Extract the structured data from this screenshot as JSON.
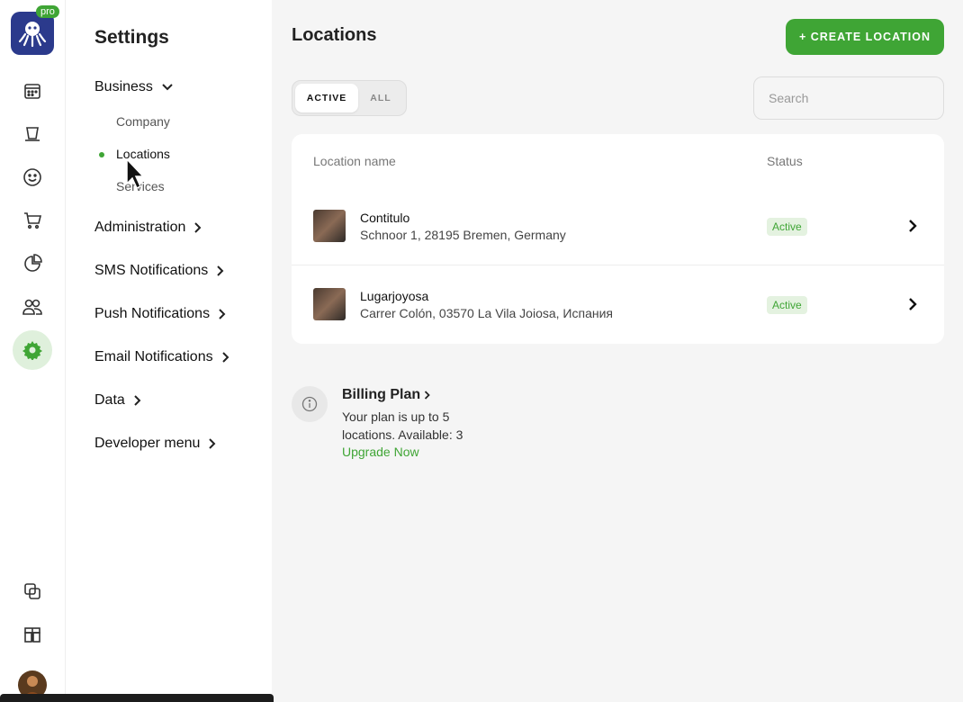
{
  "rail": {
    "pro_badge": "pro",
    "icons": [
      "calendar-icon",
      "inbox-icon",
      "smile-icon",
      "cart-icon",
      "pie-chart-icon",
      "users-icon",
      "settings-icon",
      "copy-icon",
      "apps-icon"
    ],
    "active": "settings-icon"
  },
  "settings": {
    "title": "Settings",
    "business": {
      "label": "Business",
      "items": [
        "Company",
        "Locations",
        "Services"
      ],
      "active_item": "Locations"
    },
    "groups": [
      "Administration",
      "SMS Notifications",
      "Push Notifications",
      "Email Notifications",
      "Data",
      "Developer menu"
    ]
  },
  "main": {
    "title": "Locations",
    "create_label": "+ CREATE LOCATION",
    "tabs": [
      "ACTIVE",
      "ALL"
    ],
    "active_tab": "ACTIVE",
    "search_placeholder": "Search",
    "table": {
      "headers": [
        "Location name",
        "Status"
      ],
      "rows": [
        {
          "name": "Contitulo",
          "address": "Schnoor 1, 28195 Bremen, Germany",
          "status": "Active"
        },
        {
          "name": "Lugarjoyosa",
          "address": "Carrer Colón, 03570 La Vila Joiosa, Испания",
          "status": "Active"
        }
      ]
    },
    "billing": {
      "title": "Billing Plan",
      "text": "Your plan is up to 5 locations. Available: 3",
      "upgrade": "Upgrade Now"
    }
  },
  "colors": {
    "accent": "#3fa535",
    "brand": "#2b3a8c"
  }
}
